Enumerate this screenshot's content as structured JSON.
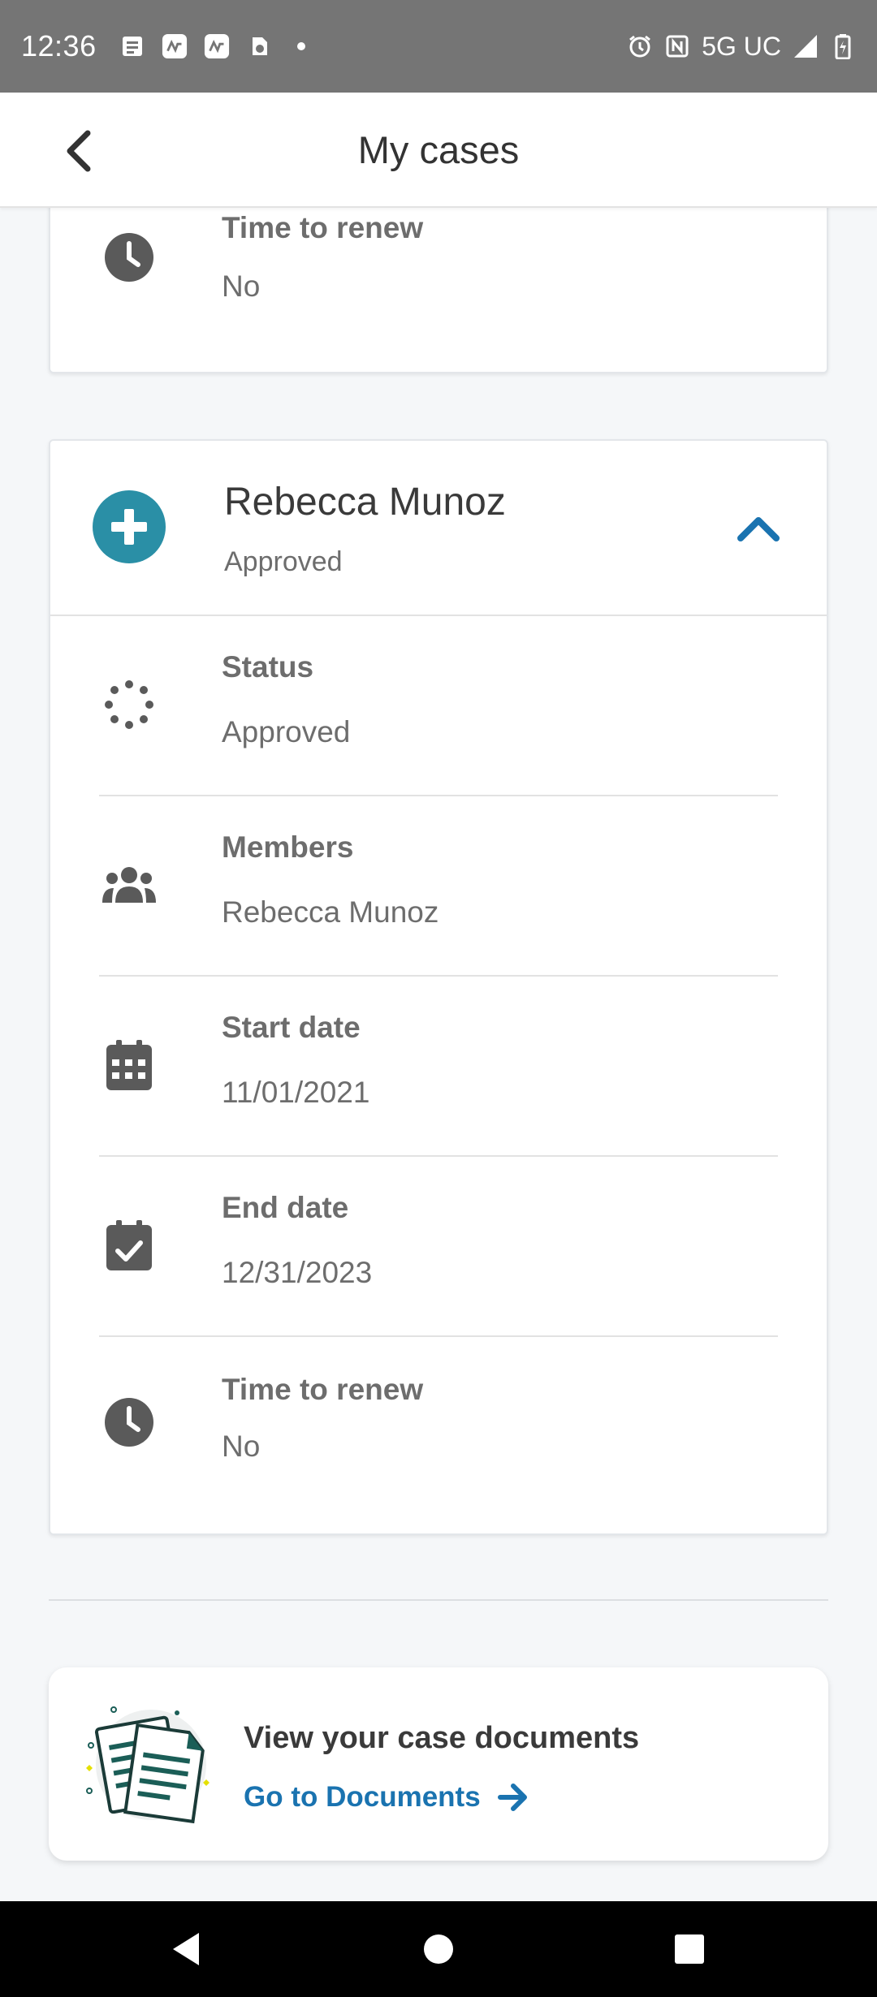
{
  "status_bar": {
    "time": "12:36",
    "network": "5G UC",
    "icons": [
      "notes-icon",
      "app-icon",
      "app-icon",
      "shield-icon",
      "dot-icon",
      "alarm-icon",
      "nfc-icon",
      "signal-icon",
      "battery-icon"
    ]
  },
  "header": {
    "title": "My cases",
    "back_icon": "chevron-left-icon"
  },
  "previous_case": {
    "time_to_renew_label": "Time to renew",
    "time_to_renew_value": "No"
  },
  "case": {
    "name": "Rebecca Munoz",
    "status": "Approved",
    "avatar_icon": "plus-icon",
    "avatar_color": "#2a8fa6",
    "details": [
      {
        "label": "Status",
        "value": "Approved",
        "icon": "spinner-icon"
      },
      {
        "label": "Members",
        "value": "Rebecca Munoz",
        "icon": "group-icon"
      },
      {
        "label": "Start date",
        "value": "11/01/2021",
        "icon": "calendar-icon"
      },
      {
        "label": "End date",
        "value": "12/31/2023",
        "icon": "calendar-check-icon"
      },
      {
        "label": "Time to renew",
        "value": "No",
        "icon": "clock-icon"
      }
    ]
  },
  "documents": {
    "title": "View your case documents",
    "link_label": "Go to Documents",
    "accent": "#1a73b0"
  },
  "nav_bar": {
    "buttons": [
      "back-nav-icon",
      "home-nav-icon",
      "recents-nav-icon"
    ]
  }
}
